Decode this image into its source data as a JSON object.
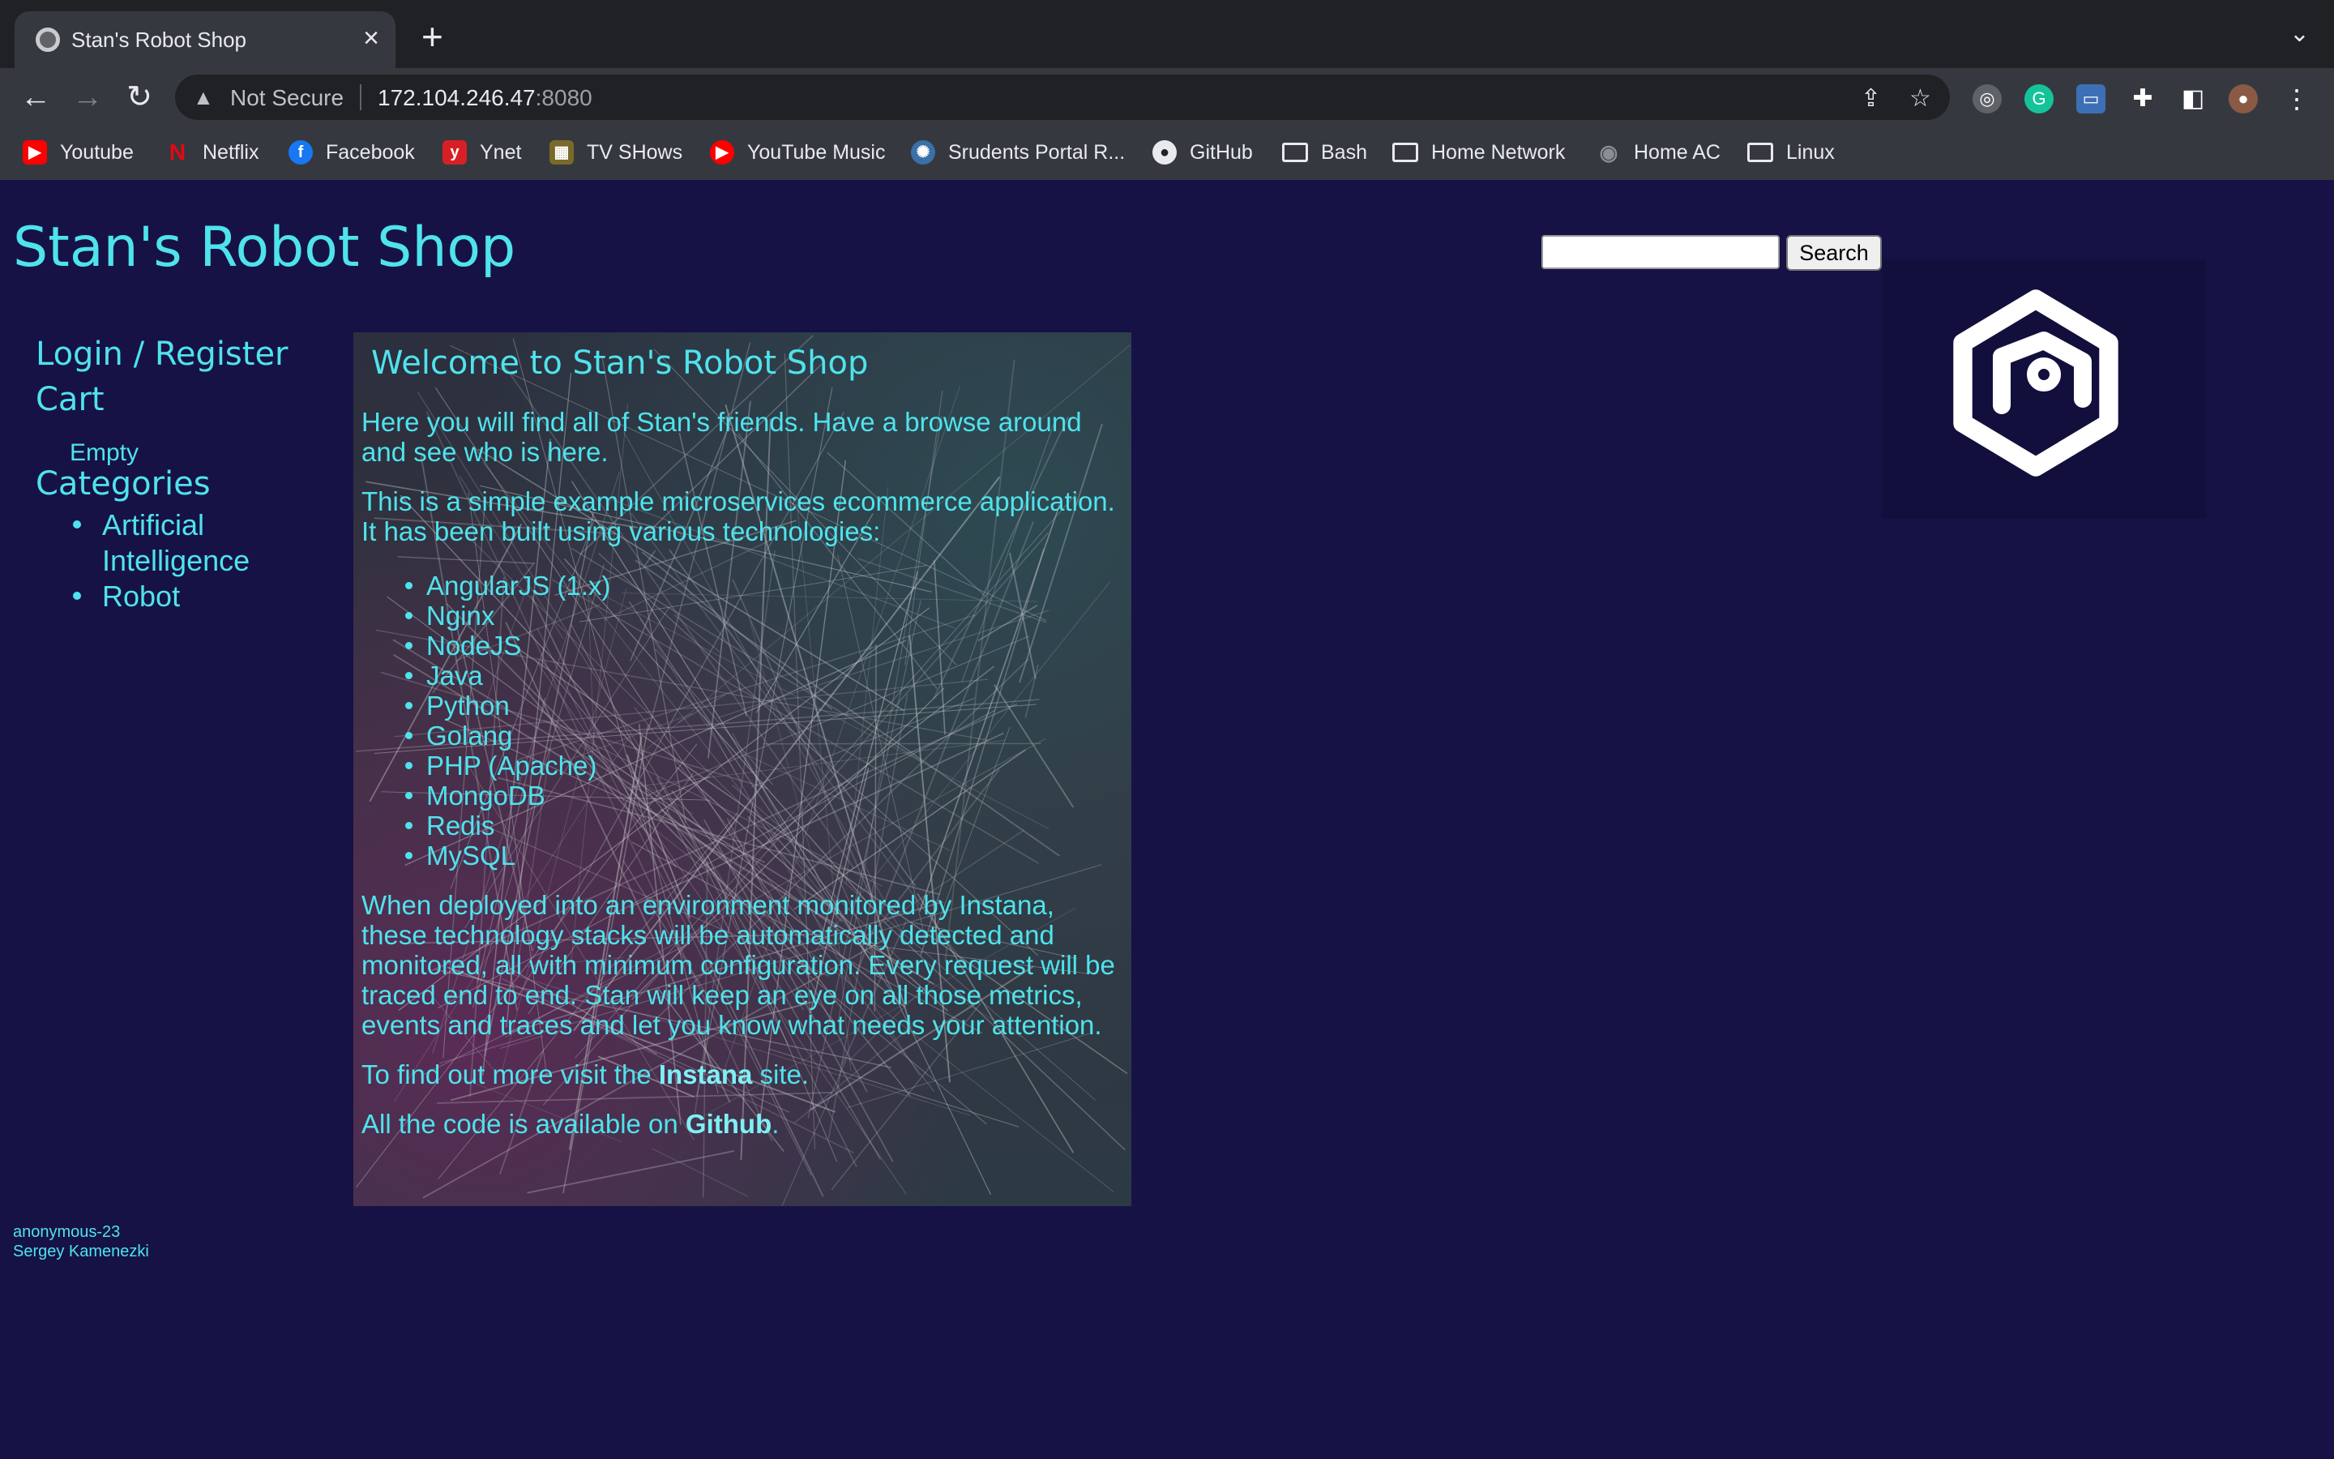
{
  "browser": {
    "tab_title": "Stan's Robot Shop",
    "not_secure": "Not Secure",
    "url_host": "172.104.246.47",
    "url_port": ":8080",
    "bookmarks": [
      {
        "label": "Youtube",
        "icon": "youtube-icon"
      },
      {
        "label": "Netflix",
        "icon": "netflix-icon"
      },
      {
        "label": "Facebook",
        "icon": "facebook-icon"
      },
      {
        "label": "Ynet",
        "icon": "ynet-icon"
      },
      {
        "label": "TV SHows",
        "icon": "tv-icon"
      },
      {
        "label": "YouTube Music",
        "icon": "youtube-music-icon"
      },
      {
        "label": "Srudents Portal R...",
        "icon": "portal-icon"
      },
      {
        "label": "GitHub",
        "icon": "github-icon"
      },
      {
        "label": "Bash",
        "icon": "folder-icon"
      },
      {
        "label": "Home Network",
        "icon": "folder-icon"
      },
      {
        "label": "Home AC",
        "icon": "ac-icon"
      },
      {
        "label": "Linux",
        "icon": "folder-icon"
      }
    ]
  },
  "header": {
    "title": "Stan's Robot Shop",
    "search_value": "",
    "search_button": "Search"
  },
  "sidebar": {
    "login": "Login / Register",
    "cart": "Cart",
    "cart_status": "Empty",
    "categories": "Categories",
    "category_items": [
      "Artificial Intelligence",
      "Robot"
    ]
  },
  "main": {
    "heading": "Welcome to Stan's Robot Shop",
    "intro": "Here you will find all of Stan's friends. Have a browse around and see who is here.",
    "desc": "This is a simple example microservices ecommerce application. It has been built using various technologies:",
    "technologies": [
      "AngularJS (1.x)",
      "Nginx",
      "NodeJS",
      "Java",
      "Python",
      "Golang",
      "PHP (Apache)",
      "MongoDB",
      "Redis",
      "MySQL"
    ],
    "monitoring": "When deployed into an environment monitored by Instana, these technology stacks will be automatically detected and monitored, all with minimum configuration. Every request will be traced end to end. Stan will keep an eye on all those metrics, events and traces and let you know what needs your attention.",
    "find_more_prefix": "To find out more visit the ",
    "find_more_link": "Instana",
    "find_more_suffix": " site.",
    "code_prefix": "All the code is available on ",
    "code_link": "Github",
    "code_suffix": "."
  },
  "footer": {
    "user": "anonymous-23",
    "author": "Sergey Kamenezki"
  },
  "colors": {
    "page_bg": "#161246",
    "accent": "#4fe3ec",
    "chrome_bg": "#35393f"
  }
}
